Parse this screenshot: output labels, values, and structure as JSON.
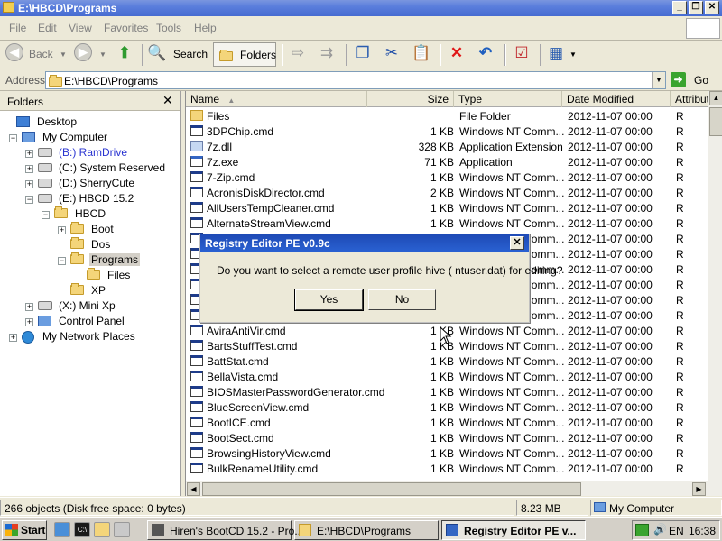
{
  "window": {
    "title": "E:\\HBCD\\Programs",
    "controls": [
      "_",
      "❐",
      "✕"
    ]
  },
  "menu": [
    "File",
    "Edit",
    "View",
    "Favorites",
    "Tools",
    "Help"
  ],
  "toolbar": {
    "back_label": "Back",
    "search_label": "Search",
    "folders_label": "Folders"
  },
  "address": {
    "label": "Address",
    "value": "E:\\HBCD\\Programs",
    "go_label": "Go"
  },
  "folders_pane": {
    "title": "Folders",
    "close": "✕",
    "tree": [
      {
        "label": "Desktop",
        "icon": "desktop-icon",
        "exp": ""
      },
      {
        "label": "My Computer",
        "icon": "computer-icon",
        "exp": "−"
      },
      {
        "label": "(B:) RamDrive",
        "icon": "drive-icon",
        "exp": "+",
        "color": "#2a34d1"
      },
      {
        "label": "(C:) System Reserved",
        "icon": "drive-icon",
        "exp": "+"
      },
      {
        "label": "(D:) SherryCute",
        "icon": "drive-icon",
        "exp": "+"
      },
      {
        "label": "(E:) HBCD 15.2",
        "icon": "cd-drive-icon",
        "exp": "−"
      },
      {
        "label": "HBCD",
        "icon": "folder-icon",
        "exp": "−"
      },
      {
        "label": "Boot",
        "icon": "folder-icon",
        "exp": "+"
      },
      {
        "label": "Dos",
        "icon": "folder-icon",
        "exp": ""
      },
      {
        "label": "Programs",
        "icon": "folder-icon",
        "exp": "−",
        "selected": true
      },
      {
        "label": "Files",
        "icon": "folder-icon",
        "exp": ""
      },
      {
        "label": "XP",
        "icon": "folder-icon",
        "exp": ""
      },
      {
        "label": "(X:) Mini Xp",
        "icon": "drive-icon",
        "exp": "+"
      },
      {
        "label": "Control Panel",
        "icon": "control-panel-icon",
        "exp": "+"
      },
      {
        "label": "My Network Places",
        "icon": "network-icon",
        "exp": "+"
      }
    ]
  },
  "file_list": {
    "columns": [
      "Name",
      "Size",
      "Type",
      "Date Modified",
      "Attribut"
    ],
    "sort_indicator": "▲",
    "rows": [
      {
        "name": "Files",
        "size": "",
        "type": "File Folder",
        "date": "2012-11-07 00:00",
        "attr": "R",
        "kind": "fold"
      },
      {
        "name": "3DPChip.cmd",
        "size": "1 KB",
        "type": "Windows NT Comm...",
        "date": "2012-11-07 00:00",
        "attr": "R",
        "kind": "cmd"
      },
      {
        "name": "7z.dll",
        "size": "328 KB",
        "type": "Application Extension",
        "date": "2012-11-07 00:00",
        "attr": "R",
        "kind": "dll"
      },
      {
        "name": "7z.exe",
        "size": "71 KB",
        "type": "Application",
        "date": "2012-11-07 00:00",
        "attr": "R",
        "kind": "exe"
      },
      {
        "name": "7-Zip.cmd",
        "size": "1 KB",
        "type": "Windows NT Comm...",
        "date": "2012-11-07 00:00",
        "attr": "R",
        "kind": "cmd"
      },
      {
        "name": "AcronisDiskDirector.cmd",
        "size": "2 KB",
        "type": "Windows NT Comm...",
        "date": "2012-11-07 00:00",
        "attr": "R",
        "kind": "cmd"
      },
      {
        "name": "AllUsersTempCleaner.cmd",
        "size": "1 KB",
        "type": "Windows NT Comm...",
        "date": "2012-11-07 00:00",
        "attr": "R",
        "kind": "cmd"
      },
      {
        "name": "AlternateStreamView.cmd",
        "size": "1 KB",
        "type": "Windows NT Comm...",
        "date": "2012-11-07 00:00",
        "attr": "R",
        "kind": "cmd"
      },
      {
        "name": "",
        "size": "",
        "type": "Windows NT Comm...",
        "date": "2012-11-07 00:00",
        "attr": "R",
        "kind": "cmd"
      },
      {
        "name": "",
        "size": "",
        "type": "Windows NT Comm...",
        "date": "2012-11-07 00:00",
        "attr": "R",
        "kind": "cmd"
      },
      {
        "name": "",
        "size": "",
        "type": "Windows NT Comm...",
        "date": "2012-11-07 00:00",
        "attr": "R",
        "kind": "cmd"
      },
      {
        "name": "",
        "size": "",
        "type": "Windows NT Comm...",
        "date": "2012-11-07 00:00",
        "attr": "R",
        "kind": "cmd"
      },
      {
        "name": "",
        "size": "",
        "type": "Windows NT Comm...",
        "date": "2012-11-07 00:00",
        "attr": "R",
        "kind": "cmd"
      },
      {
        "name": "",
        "size": "",
        "type": "Windows NT Comm...",
        "date": "2012-11-07 00:00",
        "attr": "R",
        "kind": "cmd"
      },
      {
        "name": "AviraAntiVir.cmd",
        "size": "1 KB",
        "type": "Windows NT Comm...",
        "date": "2012-11-07 00:00",
        "attr": "R",
        "kind": "cmd"
      },
      {
        "name": "BartsStuffTest.cmd",
        "size": "1 KB",
        "type": "Windows NT Comm...",
        "date": "2012-11-07 00:00",
        "attr": "R",
        "kind": "cmd"
      },
      {
        "name": "BattStat.cmd",
        "size": "1 KB",
        "type": "Windows NT Comm...",
        "date": "2012-11-07 00:00",
        "attr": "R",
        "kind": "cmd"
      },
      {
        "name": "BellaVista.cmd",
        "size": "1 KB",
        "type": "Windows NT Comm...",
        "date": "2012-11-07 00:00",
        "attr": "R",
        "kind": "cmd"
      },
      {
        "name": "BIOSMasterPasswordGenerator.cmd",
        "size": "1 KB",
        "type": "Windows NT Comm...",
        "date": "2012-11-07 00:00",
        "attr": "R",
        "kind": "cmd"
      },
      {
        "name": "BlueScreenView.cmd",
        "size": "1 KB",
        "type": "Windows NT Comm...",
        "date": "2012-11-07 00:00",
        "attr": "R",
        "kind": "cmd"
      },
      {
        "name": "BootICE.cmd",
        "size": "1 KB",
        "type": "Windows NT Comm...",
        "date": "2012-11-07 00:00",
        "attr": "R",
        "kind": "cmd"
      },
      {
        "name": "BootSect.cmd",
        "size": "1 KB",
        "type": "Windows NT Comm...",
        "date": "2012-11-07 00:00",
        "attr": "R",
        "kind": "cmd"
      },
      {
        "name": "BrowsingHistoryView.cmd",
        "size": "1 KB",
        "type": "Windows NT Comm...",
        "date": "2012-11-07 00:00",
        "attr": "R",
        "kind": "cmd"
      },
      {
        "name": "BulkRenameUtility.cmd",
        "size": "1 KB",
        "type": "Windows NT Comm...",
        "date": "2012-11-07 00:00",
        "attr": "R",
        "kind": "cmd"
      }
    ]
  },
  "status": {
    "objects": "266 objects (Disk free space: 0 bytes)",
    "size": "8.23 MB",
    "location": "My Computer"
  },
  "dialog": {
    "title": "Registry Editor PE  v0.9c",
    "close": "✕",
    "message": "Do you want to select a remote user profile hive ( ntuser.dat) for editing?",
    "yes_label": "Yes",
    "no_label": "No"
  },
  "taskbar": {
    "start_label": "Start",
    "tasks": [
      {
        "label": "Hiren's BootCD 15.2 - Pro...",
        "active": false
      },
      {
        "label": "E:\\HBCD\\Programs",
        "active": false
      },
      {
        "label": "Registry Editor PE v...",
        "active": true
      }
    ],
    "language": "EN",
    "clock": "16:38"
  }
}
